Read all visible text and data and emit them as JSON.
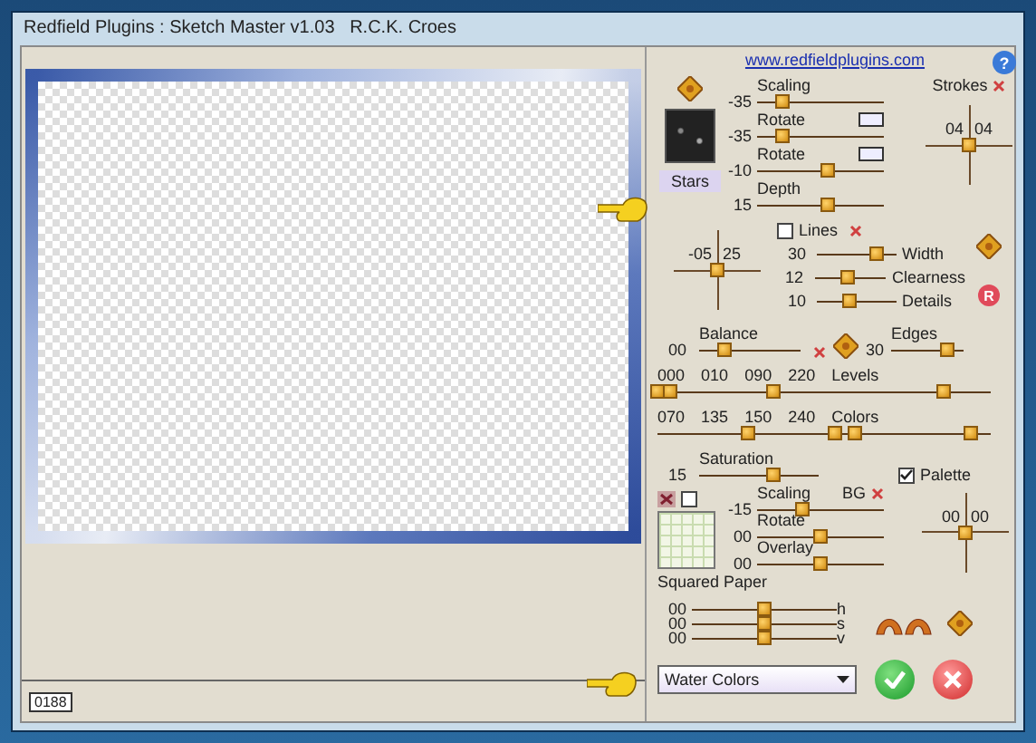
{
  "window": {
    "title": "Redfield Plugins : Sketch Master v1.03   R.C.K. Croes"
  },
  "preview": {
    "counter": "0188"
  },
  "link": "www.redfieldplugins.com",
  "help": "?",
  "reset": "R",
  "strokes": {
    "thumbnail_label": "Stars",
    "label": "Strokes",
    "crosshair": [
      "04",
      "04"
    ],
    "sliders": [
      {
        "kind": "plain",
        "label": "Scaling",
        "value": "-35",
        "level": 0.2
      },
      {
        "kind": "toggle",
        "label": "Rotate",
        "value": "-35",
        "level": 0.2
      },
      {
        "kind": "toggle",
        "label": "Rotate",
        "value": "-10",
        "level": 0.55
      },
      {
        "kind": "plain",
        "label": "Depth",
        "value": "15",
        "level": 0.55
      }
    ]
  },
  "lines": {
    "label": "Lines",
    "checked": false,
    "crosshair": [
      "-05",
      "25"
    ],
    "sliders": [
      {
        "label": "Width",
        "value": "30",
        "level": 0.75
      },
      {
        "label": "Clearness",
        "value": "12",
        "level": 0.45
      },
      {
        "label": "Details",
        "value": "10",
        "level": 0.42
      }
    ]
  },
  "balance": {
    "label": "Balance",
    "value": "00",
    "level": 0.25
  },
  "edges": {
    "label": "Edges",
    "value": "30",
    "level": 0.78
  },
  "levels": {
    "label": "Levels",
    "values": [
      "000",
      "010",
      "090",
      "220"
    ],
    "thumbs": [
      {
        "level": 0.0
      },
      {
        "level": 0.04
      },
      {
        "level": 0.35
      },
      {
        "level": 0.86
      }
    ]
  },
  "colors": {
    "label": "Colors",
    "values": [
      "070",
      "135",
      "150",
      "240"
    ],
    "thumbs": [
      {
        "level": 0.27
      },
      {
        "level": 0.53
      },
      {
        "level": 0.59
      },
      {
        "level": 0.94
      }
    ]
  },
  "saturation": {
    "label": "Saturation",
    "value": "15",
    "level": 0.62
  },
  "palette": {
    "label": "Palette",
    "checked": true
  },
  "background": {
    "label": "BG",
    "checked": false,
    "paper_label": "Squared Paper",
    "crosshair": [
      "00",
      "00"
    ],
    "sliders": [
      {
        "label": "Scaling",
        "value": "-15",
        "level": 0.35
      },
      {
        "label": "Rotate",
        "value": "00",
        "level": 0.5
      },
      {
        "label": "Overlay",
        "value": "00",
        "level": 0.5
      }
    ]
  },
  "hsv": [
    {
      "label": "h",
      "value": "00",
      "level": 0.5
    },
    {
      "label": "s",
      "value": "00",
      "level": 0.5
    },
    {
      "label": "v",
      "value": "00",
      "level": 0.5
    }
  ],
  "preset": {
    "value": "Water Colors"
  }
}
